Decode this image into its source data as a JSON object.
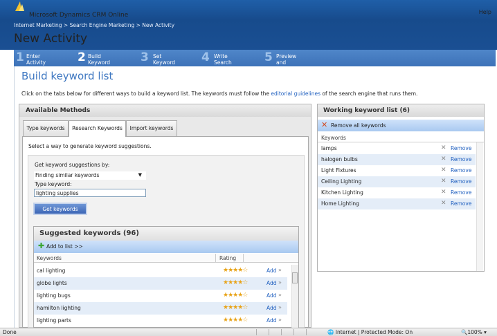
{
  "app": {
    "product": "Microsoft Dynamics CRM Online",
    "help": "Help"
  },
  "breadcrumb": "Internet Marketing > Search Engine Marketing > New Activity",
  "page_title": "New Activity",
  "steps": [
    {
      "num": "1",
      "label": "Enter Activity\nDetails"
    },
    {
      "num": "2",
      "label": "Build Keyword List"
    },
    {
      "num": "3",
      "label": "Set Keyword Bids"
    },
    {
      "num": "4",
      "label": "Write Search Ads"
    },
    {
      "num": "5",
      "label": "Preview and\nLaunch"
    }
  ],
  "build": {
    "title": "Build keyword list",
    "intro_before": "Click on the tabs below for different ways to build a keyword list. The keywords must follow the ",
    "intro_link": "editorial guidelines",
    "intro_after": " of the search engine that runs them."
  },
  "available": {
    "header": "Available Methods",
    "tabs": [
      "Type keywords",
      "Research Keywords",
      "Import keywords"
    ],
    "select_prompt": "Select a way to generate keyword suggestions.",
    "get_by_label": "Get keyword suggestions by:",
    "dropdown_value": "Finding similar keywords",
    "type_keyword_label": "Type keyword:",
    "keyword_value": "lighting supplies",
    "get_button": "Get keywords"
  },
  "suggested": {
    "header": "Suggested keywords (96)",
    "add_label": "Add to list >>",
    "col_keywords": "Keywords",
    "col_rating": "Rating",
    "rows": [
      {
        "keyword": "cal lighting",
        "rating": 4,
        "add": "Add"
      },
      {
        "keyword": "globe lights",
        "rating": 4,
        "add": "Add"
      },
      {
        "keyword": "lighting bugs",
        "rating": 4,
        "add": "Add"
      },
      {
        "keyword": "hamilton lighting",
        "rating": 4,
        "add": "Add"
      },
      {
        "keyword": "lighting parts",
        "rating": 4,
        "add": "Add"
      }
    ]
  },
  "working": {
    "header": "Working keyword list (6)",
    "remove_all": "Remove all keywords",
    "col_keywords": "Keywords",
    "rows": [
      {
        "keyword": "lamps",
        "remove": "Remove"
      },
      {
        "keyword": "halogen bulbs",
        "remove": "Remove"
      },
      {
        "keyword": "Light Fixtures",
        "remove": "Remove"
      },
      {
        "keyword": "Ceiling Lighting",
        "remove": "Remove"
      },
      {
        "keyword": "Kitchen Lighting",
        "remove": "Remove"
      },
      {
        "keyword": "Home Lighting",
        "remove": "Remove"
      }
    ]
  },
  "status": {
    "left": "Done",
    "zone": "Internet | Protected Mode: On",
    "zoom": "100%"
  },
  "colors": {
    "header": "#1a4f93",
    "steps": "#3d72b8",
    "accent": "#3e77c1",
    "link": "#1f5fbf",
    "star": "#e8a317"
  }
}
